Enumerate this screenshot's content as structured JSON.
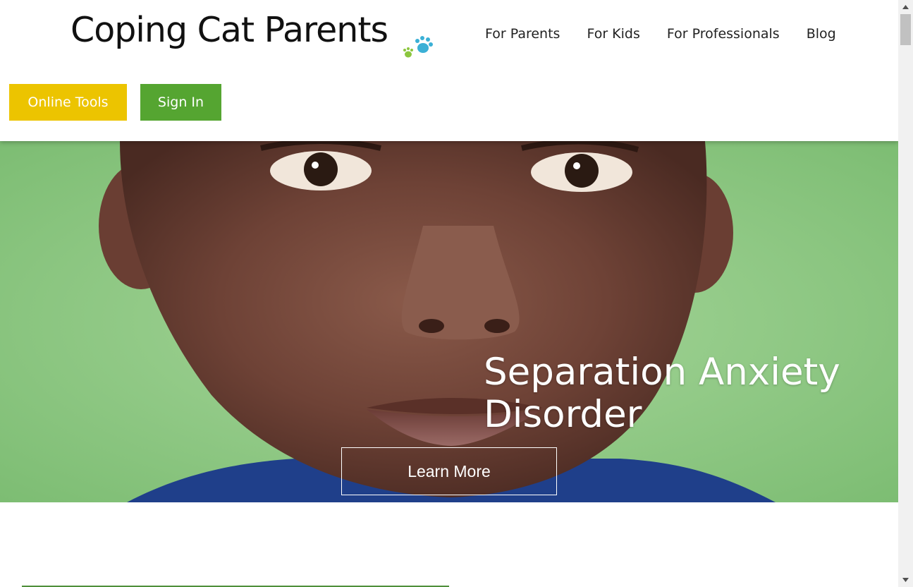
{
  "header": {
    "logo_text": "Coping Cat Parents",
    "nav": [
      "For Parents",
      "For Kids",
      "For Professionals",
      "Blog"
    ],
    "online_tools_label": "Online Tools",
    "sign_in_label": "Sign In"
  },
  "hero": {
    "title_line1": "Separation Anxiety",
    "title_line2": "Disorder",
    "cta_label": "Learn More"
  },
  "colors": {
    "online_tools": "#ecc400",
    "sign_in": "#55a531",
    "paw_blue": "#3bb0d6",
    "paw_green": "#8cc63f"
  }
}
